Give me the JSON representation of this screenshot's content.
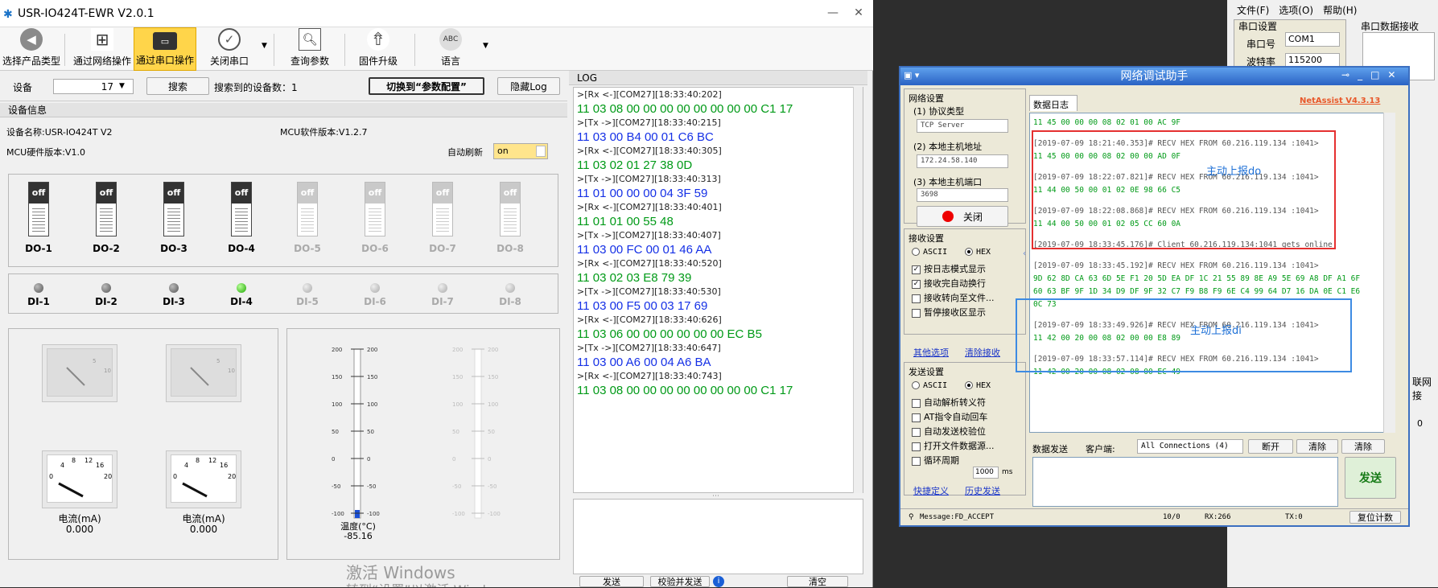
{
  "app": {
    "title": "USR-IO424T-EWR V2.0.1",
    "toolbar": [
      {
        "label": "选择产品类型",
        "icon": "back-arrow-icon"
      },
      {
        "label": "通过网络操作",
        "icon": "network-icon"
      },
      {
        "label": "通过串口操作",
        "icon": "serial-port-icon",
        "active": true
      },
      {
        "label": "关闭串口",
        "icon": "checkmark-pin-icon"
      },
      {
        "label": "查询参数",
        "icon": "search-document-icon"
      },
      {
        "label": "固件升级",
        "icon": "rocket-icon"
      },
      {
        "label": "语言",
        "icon": "globe-abc-icon"
      }
    ],
    "device_label": "设备",
    "device_value": "17",
    "search_button": "搜索",
    "found_label": "搜索到的设备数：1",
    "switch_button": "切换到“参数配置”",
    "hide_log_button": "隐藏Log",
    "device_info_header": "设备信息",
    "device_name": "设备名称:USR-IO424T V2",
    "mcu_sw": "MCU软件版本:V1.2.7",
    "mcu_hw": "MCU硬件版本:V1.0",
    "auto_refresh_label": "自动刷新",
    "auto_refresh_value": "on",
    "do_items": [
      {
        "label": "DO-1",
        "state": "off",
        "enabled": true
      },
      {
        "label": "DO-2",
        "state": "off",
        "enabled": true
      },
      {
        "label": "DO-3",
        "state": "off",
        "enabled": true
      },
      {
        "label": "DO-4",
        "state": "off",
        "enabled": true
      },
      {
        "label": "DO-5",
        "state": "off",
        "enabled": false
      },
      {
        "label": "DO-6",
        "state": "off",
        "enabled": false
      },
      {
        "label": "DO-7",
        "state": "off",
        "enabled": false
      },
      {
        "label": "DO-8",
        "state": "off",
        "enabled": false
      }
    ],
    "di_items": [
      {
        "label": "DI-1",
        "on": false,
        "enabled": true
      },
      {
        "label": "DI-2",
        "on": false,
        "enabled": true
      },
      {
        "label": "DI-3",
        "on": false,
        "enabled": true
      },
      {
        "label": "DI-4",
        "on": true,
        "enabled": true
      },
      {
        "label": "DI-5",
        "on": false,
        "enabled": false
      },
      {
        "label": "DI-6",
        "on": false,
        "enabled": false
      },
      {
        "label": "DI-7",
        "on": false,
        "enabled": false
      },
      {
        "label": "DI-8",
        "on": false,
        "enabled": false
      }
    ],
    "gauges": [
      {
        "label": "电流(mA)",
        "value": "0.000",
        "ticks": [
          "0",
          "4",
          "8",
          "12",
          "16",
          "20"
        ]
      },
      {
        "label": "电流(mA)",
        "value": "0.000",
        "ticks": [
          "0",
          "4",
          "8",
          "12",
          "16",
          "20"
        ]
      }
    ],
    "thermometer": {
      "label": "温度(°C)",
      "value": "-85.16",
      "ticks": [
        "200",
        "150",
        "100",
        "50",
        "0",
        "-50",
        "-100"
      ]
    },
    "log_header": "LOG",
    "log": [
      {
        "head": ">[Rx <-][COM27][18:33:40:202]",
        "data": "11 03 08 00 00 00 00 00 00 00 00 C1 17",
        "dir": "rx"
      },
      {
        "head": ">[Tx ->][COM27][18:33:40:215]",
        "data": "11 03 00 B4 00 01 C6 BC",
        "dir": "tx"
      },
      {
        "head": ">[Rx <-][COM27][18:33:40:305]",
        "data": "11 03 02 01 27 38 0D",
        "dir": "rx"
      },
      {
        "head": ">[Tx ->][COM27][18:33:40:313]",
        "data": "11 01 00 00 00 04 3F 59",
        "dir": "tx"
      },
      {
        "head": ">[Rx <-][COM27][18:33:40:401]",
        "data": "11 01 01 00 55 48",
        "dir": "rx"
      },
      {
        "head": ">[Tx ->][COM27][18:33:40:407]",
        "data": "11 03 00 FC 00 01 46 AA",
        "dir": "tx"
      },
      {
        "head": ">[Rx <-][COM27][18:33:40:520]",
        "data": "11 03 02 03 E8 79 39",
        "dir": "rx"
      },
      {
        "head": ">[Tx ->][COM27][18:33:40:530]",
        "data": "11 03 00 F5 00 03 17 69",
        "dir": "tx"
      },
      {
        "head": ">[Rx <-][COM27][18:33:40:626]",
        "data": "11 03 06 00 00 00 00 00 00 EC B5",
        "dir": "rx"
      },
      {
        "head": ">[Tx ->][COM27][18:33:40:647]",
        "data": "11 03 00 A6 00 04 A6 BA",
        "dir": "tx"
      },
      {
        "head": ">[Rx <-][COM27][18:33:40:743]",
        "data": "11 03 08 00 00 00 00 00 00 00 00 C1 17",
        "dir": "rx"
      }
    ],
    "send_button": "发送",
    "checksum_button": "校验并发送",
    "clear_button": "清空",
    "watermark_line1": "激活 Windows",
    "watermark_line2": "转到“设置”以激活 Windows"
  },
  "net": {
    "title": "网络调试助手",
    "version": "NetAssist V4.3.13",
    "net_settings": "网络设置",
    "protocol_label": "(1) 协议类型",
    "protocol_value": "TCP Server",
    "host_label": "(2) 本地主机地址",
    "host_value": "172.24.58.140",
    "port_label": "(3) 本地主机端口",
    "port_value": "3698",
    "close_button": "关闭",
    "recv_settings": "接收设置",
    "ascii": "ASCII",
    "hex": "HEX",
    "recv_opts": [
      "按日志模式显示",
      "接收完自动换行",
      "接收转向至文件...",
      "暂停接收区显示"
    ],
    "recv_checked": [
      true,
      true,
      false,
      false
    ],
    "more_options": "其他选项",
    "clear_recv": "清除接收",
    "send_settings": "发送设置",
    "send_opts": [
      "自动解析转义符",
      "AT指令自动回车",
      "自动发送校验位",
      "打开文件数据源...",
      "循环周期"
    ],
    "cycle_value": "1000",
    "cycle_unit": "ms",
    "shortcut": "快捷定义",
    "history": "历史发送",
    "data_log_tab": "数据日志",
    "recv_lines": [
      {
        "t": "data",
        "s": "11 45 00 00 00 08 02 01 00 AC 9F"
      },
      {
        "t": "blank",
        "s": ""
      },
      {
        "t": "head",
        "s": "[2019-07-09 18:21:40.353]# RECV HEX FROM 60.216.119.134 :1041>"
      },
      {
        "t": "data",
        "s": "11 45 00 00 00 08 02 00 00 AD 0F"
      },
      {
        "t": "blank",
        "s": ""
      },
      {
        "t": "head",
        "s": "[2019-07-09 18:22:07.821]# RECV HEX FROM 60.216.119.134 :1041>"
      },
      {
        "t": "data",
        "s": "11 44 00 50 00 01 02 0E 98 66 C5"
      },
      {
        "t": "blank",
        "s": ""
      },
      {
        "t": "head",
        "s": "[2019-07-09 18:22:08.868]# RECV HEX FROM 60.216.119.134 :1041>"
      },
      {
        "t": "data",
        "s": "11 44 00 50 00 01 02 05 CC 60 0A"
      },
      {
        "t": "blank",
        "s": ""
      },
      {
        "t": "head",
        "s": "[2019-07-09 18:33:45.176]# Client 60.216.119.134:1041 gets online."
      },
      {
        "t": "blank",
        "s": ""
      },
      {
        "t": "head",
        "s": "[2019-07-09 18:33:45.192]# RECV HEX FROM 60.216.119.134 :1041>"
      },
      {
        "t": "data",
        "s": "9D 62 8D CA 63 6D 5E F1 20 5D EA DF 1C 21 55 89 8E A9 5E 69 A8 DF A1 6F"
      },
      {
        "t": "data",
        "s": "60 63 BF 9F 1D 34 D9 DF 9F 32 C7 F9 B8 F9 6E C4 99 64 D7 16 DA 0E C1 E6"
      },
      {
        "t": "data",
        "s": "0C 73"
      },
      {
        "t": "blank",
        "s": ""
      },
      {
        "t": "head",
        "s": "[2019-07-09 18:33:49.926]# RECV HEX FROM 60.216.119.134 :1041>"
      },
      {
        "t": "data",
        "s": "11 42 00 20 00 08 02 00 00 E8 89"
      },
      {
        "t": "blank",
        "s": ""
      },
      {
        "t": "head",
        "s": "[2019-07-09 18:33:57.114]# RECV HEX FROM 60.216.119.134 :1041>"
      },
      {
        "t": "data",
        "s": "11 42 00 20 00 08 02 08 00 EC 49"
      }
    ],
    "annot_do": "主动上报do",
    "annot_di": "主动上报di",
    "data_send": "数据发送",
    "client_label": "客户端:",
    "client_value": "All Connections (4)",
    "disconnect": "断开",
    "clear1": "清除",
    "clear2": "清除",
    "send_button": "发送",
    "status_msg": "Message:FD_ACCEPT",
    "status_count": "10/0",
    "status_rx": "RX:266",
    "status_tx": "TX:0",
    "reset_count": "复位计数"
  },
  "far": {
    "menu": [
      "文件(F)",
      "选项(O)",
      "帮助(H)"
    ],
    "serial_settings": "串口设置",
    "port_label": "串口号",
    "port_value": "COM1",
    "baud_label": "波特率",
    "baud_value": "115200",
    "recv_label": "串口数据接收",
    "side_text": "联网接",
    "side_num": "0"
  }
}
